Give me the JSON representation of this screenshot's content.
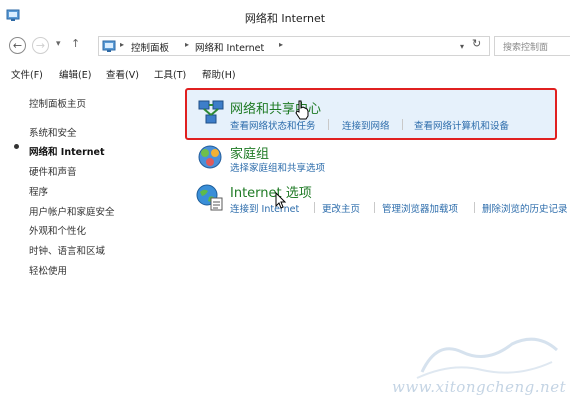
{
  "window": {
    "title": "网络和 Internet"
  },
  "address": {
    "breadcrumbs": [
      "控制面板",
      "网络和 Internet"
    ],
    "search_placeholder": "搜索控制面"
  },
  "menu": [
    "文件(F)",
    "编辑(E)",
    "查看(V)",
    "工具(T)",
    "帮助(H)"
  ],
  "sidebar": {
    "items": [
      {
        "label": "控制面板主页"
      },
      {
        "label": "系统和安全"
      },
      {
        "label": "网络和 Internet",
        "active": true
      },
      {
        "label": "硬件和声音"
      },
      {
        "label": "程序"
      },
      {
        "label": "用户帐户和家庭安全"
      },
      {
        "label": "外观和个性化"
      },
      {
        "label": "时钟、语言和区域"
      },
      {
        "label": "轻松使用"
      }
    ]
  },
  "categories": {
    "network_center": {
      "title": "网络和共享中心",
      "links": [
        "查看网络状态和任务",
        "连接到网络",
        "查看网络计算机和设备"
      ]
    },
    "homegroup": {
      "title": "家庭组",
      "links": [
        "选择家庭组和共享选项"
      ]
    },
    "internet_options": {
      "title": "Internet 选项",
      "links": [
        "连接到 Internet",
        "更改主页",
        "管理浏览器加载项",
        "删除浏览的历史记录"
      ]
    }
  },
  "watermark": {
    "text": "www.xitongcheng.net"
  },
  "colors": {
    "category_title": "#1e7a24",
    "link": "#2c6cab",
    "highlight_border": "#e02020",
    "highlight_fill": "#e6f1fb"
  }
}
